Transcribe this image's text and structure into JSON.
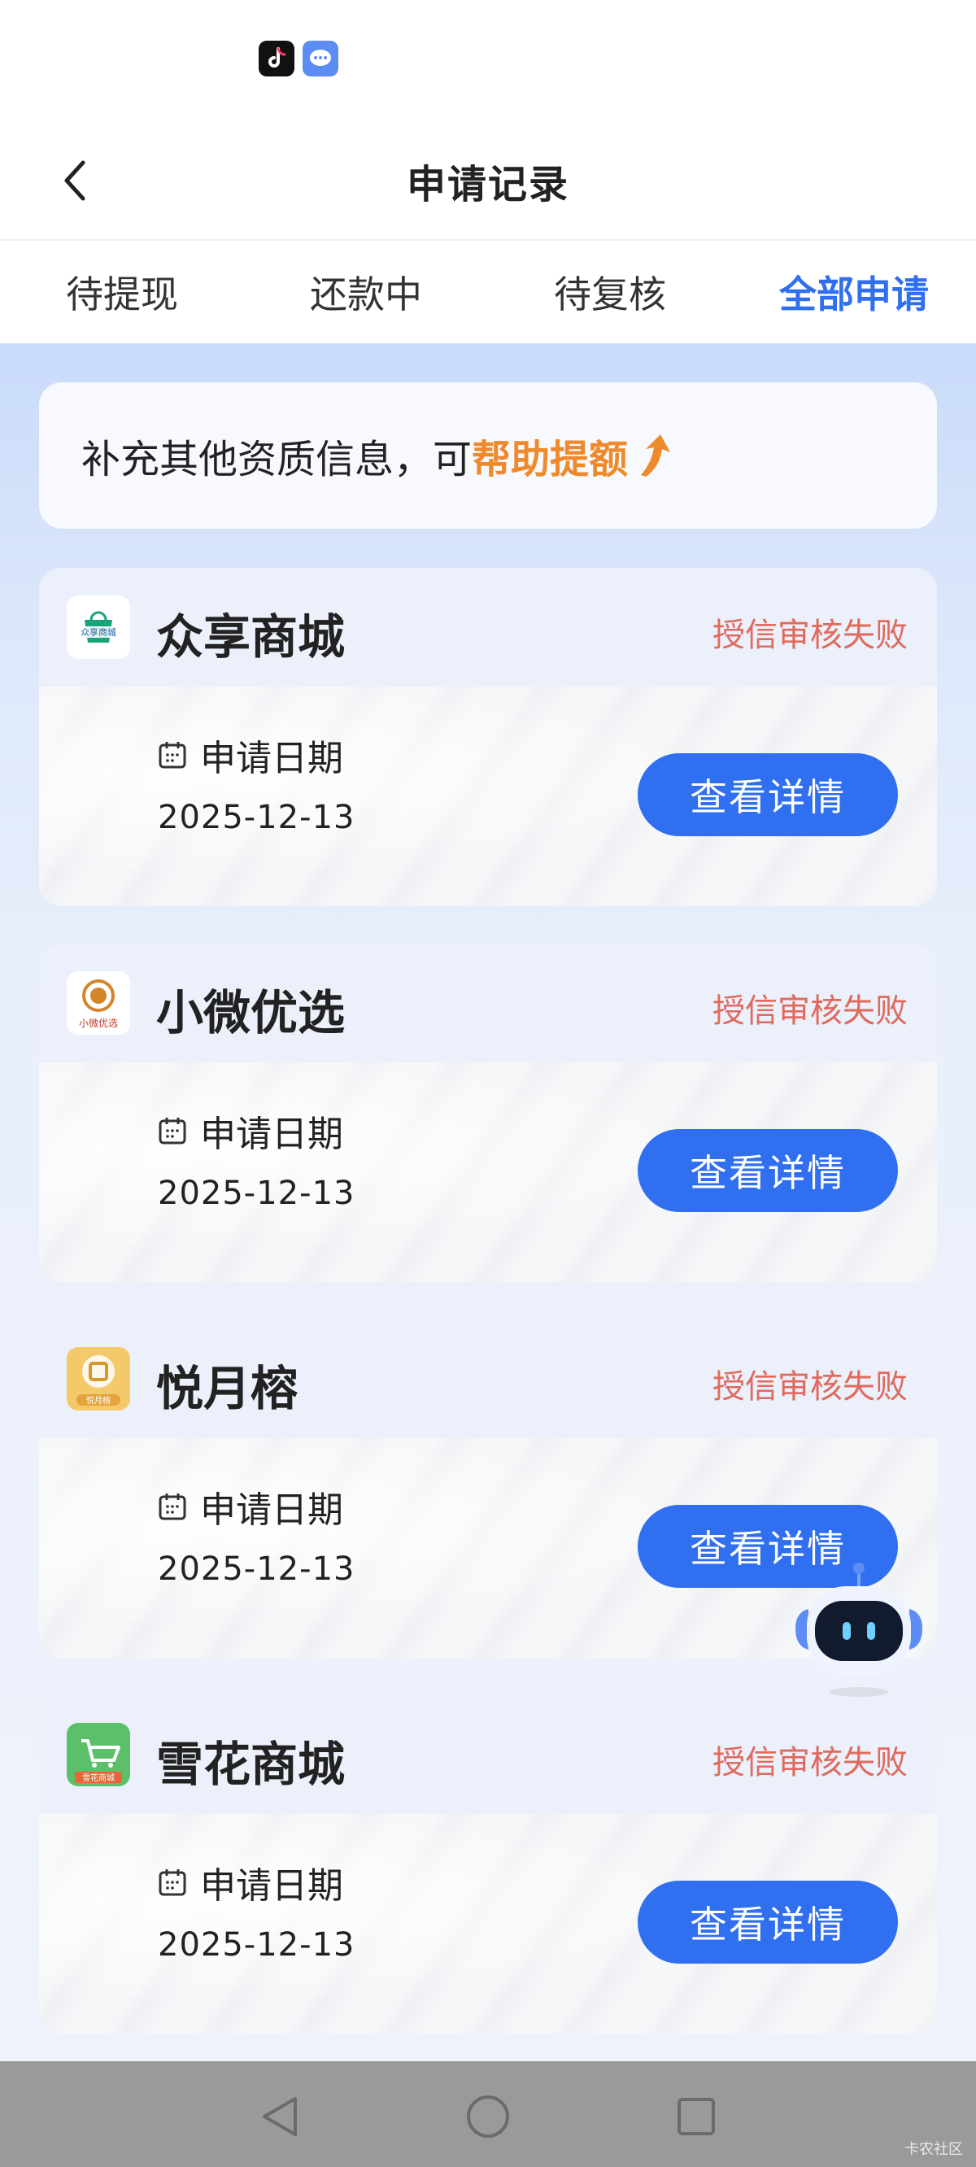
{
  "status_bar": {
    "icons": [
      "tiktok-icon",
      "message-icon"
    ]
  },
  "header": {
    "title": "申请记录"
  },
  "tabs": [
    {
      "label": "待提现",
      "active": false
    },
    {
      "label": "还款中",
      "active": false
    },
    {
      "label": "待复核",
      "active": false
    },
    {
      "label": "全部申请",
      "active": true
    }
  ],
  "banner": {
    "text": "补充其他资质信息，可",
    "highlight": "帮助提额"
  },
  "records": [
    {
      "name": "众享商城",
      "status": "授信审核失败",
      "date_label": "申请日期",
      "date": "2025-12-13",
      "button": "查看详情",
      "logo_text": "众享商城"
    },
    {
      "name": "小微优选",
      "status": "授信审核失败",
      "date_label": "申请日期",
      "date": "2025-12-13",
      "button": "查看详情",
      "logo_text": "小微优选"
    },
    {
      "name": "悦月榕",
      "status": "授信审核失败",
      "date_label": "申请日期",
      "date": "2025-12-13",
      "button": "查看详情",
      "logo_text": "悦月榕"
    },
    {
      "name": "雪花商城",
      "status": "授信审核失败",
      "date_label": "申请日期",
      "date": "2025-12-13",
      "button": "查看详情",
      "logo_text": "雪花商城"
    }
  ],
  "footer": {
    "watermark": "卡农社区"
  },
  "colors": {
    "accent": "#2f6ff0",
    "status_fail": "#e06a5c",
    "highlight": "#ee8a2c"
  }
}
